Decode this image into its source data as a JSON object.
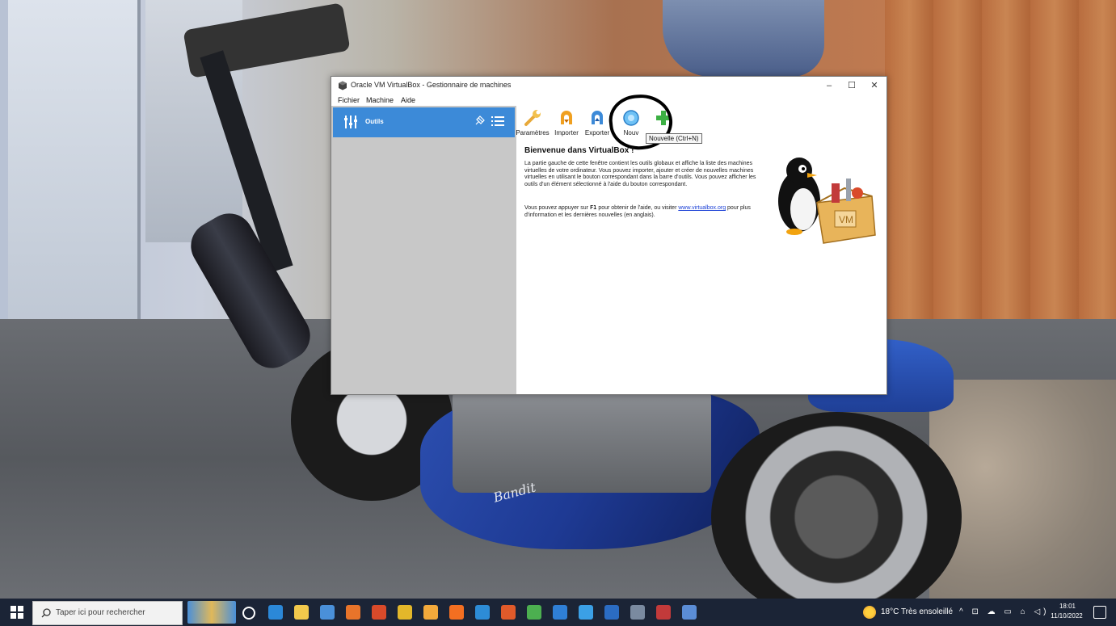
{
  "window": {
    "title": "Oracle VM VirtualBox - Gestionnaire de machines",
    "controls": {
      "minimize": "–",
      "maximize": "☐",
      "close": "✕"
    }
  },
  "menubar": [
    "Fichier",
    "Machine",
    "Aide"
  ],
  "sidebar": {
    "tools_label": "Outils"
  },
  "toolbar": {
    "params": "Paramètres",
    "import": "Importer",
    "export": "Exporter",
    "new_partial": "Nouv",
    "tooltip": "Nouvelle (Ctrl+N)"
  },
  "welcome": {
    "title": "Bienvenue dans VirtualBox !",
    "para1": "La partie gauche de cette fenêtre contient les outils globaux et affiche la liste des machines virtuelles de votre ordinateur. Vous pouvez importer, ajouter et créer de nouvelles machines virtuelles en utilisant le bouton correspondant dans la barre d'outils. Vous pouvez afficher les outils d'un élément sélectionné à l'aide du bouton correspondant.",
    "para2_before": "Vous pouvez appuyer sur ",
    "para2_key": "F1",
    "para2_mid": " pour obtenir de l'aide, ou visiter ",
    "para2_link": "www.virtualbox.org",
    "para2_after": " pour plus d'information et les dernières nouvelles (en anglais)."
  },
  "mascot_label": "VM",
  "wallpaper_text": "Bandit",
  "taskbar": {
    "search_placeholder": "Taper ici pour rechercher",
    "weather": "18°C  Très ensoleillé",
    "tray": "^ ⊡ ☁ ▭ ⌂ ◁)",
    "time": "18:01",
    "date": "11/10/2022",
    "app_colors": [
      "#ffffff",
      "#2b88d8",
      "#f2c94c",
      "#4a90d9",
      "#e8742a",
      "#d94a2a",
      "#e3b72a",
      "#f2a93b",
      "#f36f21",
      "#2d8cd6",
      "#e05a2a",
      "#4caf50",
      "#2f7fd6",
      "#3ba0e6",
      "#2b6cc2",
      "#7a8aa0",
      "#c23a3a",
      "#5b8dd6"
    ]
  },
  "colors": {
    "accent": "#3c8ad8",
    "sidebar": "#c8c8c8",
    "taskbar": "#1b2436",
    "link": "#1a3fd6"
  }
}
